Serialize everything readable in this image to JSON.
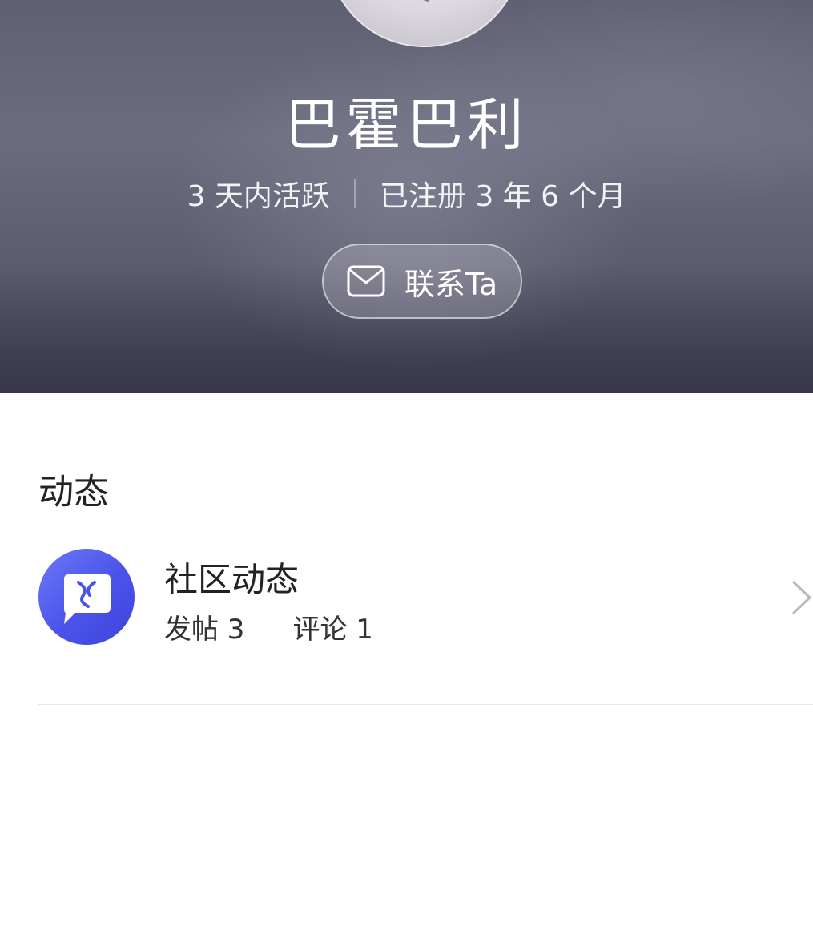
{
  "profile": {
    "name": "巴霍巴利",
    "active_text": "3 天内活跃",
    "registered_text": "已注册 3 年 6 个月",
    "contact_label": "联系Ta"
  },
  "activity": {
    "section_title": "动态",
    "item": {
      "title": "社区动态",
      "posts_label": "发帖 3",
      "comments_label": "评论 1"
    }
  },
  "icons": {
    "contact": "mail-icon",
    "community": "chat-bubble-icon",
    "row_arrow": "chevron-right-icon"
  },
  "colors": {
    "header_gradient_top": "#5f6073",
    "header_gradient_bottom": "#44435a",
    "accent_icon": "#4a53ea",
    "text_primary": "#222222"
  }
}
